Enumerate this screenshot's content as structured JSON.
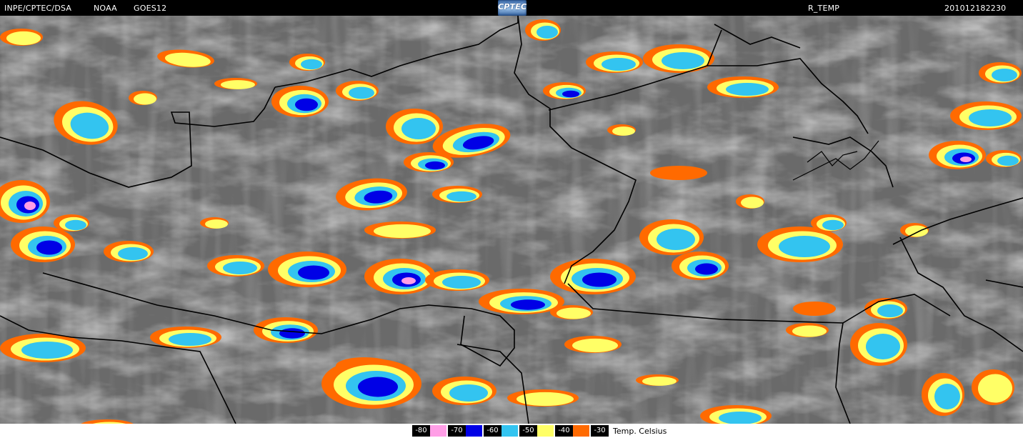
{
  "header": {
    "source": "INPE/CPTEC/DSA",
    "agency": "NOAA",
    "satellite": "GOES12",
    "product": "R_TEMP",
    "timestamp": "201012182230",
    "logo_text": "CPTEC"
  },
  "legend": {
    "title": "Temp. Celsius",
    "entries": [
      {
        "label": "-80",
        "color": "#ff9ee6"
      },
      {
        "label": "-70",
        "color": "#0000e6"
      },
      {
        "label": "-60",
        "color": "#33c4f0"
      },
      {
        "label": "-50",
        "color": "#ffff66"
      },
      {
        "label": "-40",
        "color": "#ff6a00"
      },
      {
        "label": "-30",
        "color": ""
      }
    ]
  },
  "colors": {
    "background_clouds": "#6e6e6e",
    "borders": "#000000"
  }
}
